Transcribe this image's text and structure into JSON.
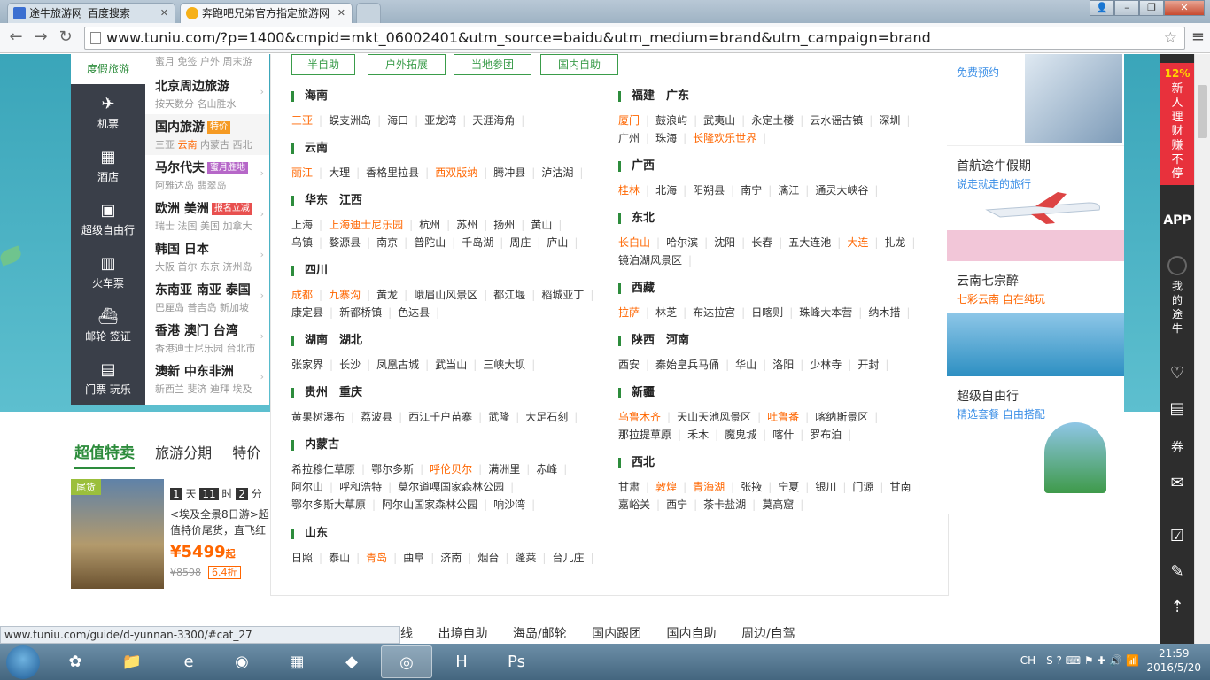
{
  "browser": {
    "tabs": [
      {
        "title": "途牛旅游网_百度搜索"
      },
      {
        "title": "奔跑吧兄弟官方指定旅游网"
      }
    ],
    "url": "www.tuniu.com/?p=1400&cmpid=mkt_06002401&utm_source=baidu&utm_medium=brand&utm_campaign=brand",
    "status_url": "www.tuniu.com/guide/d-yunnan-3300/#cat_27"
  },
  "nav": {
    "top_label": "度假旅游",
    "items": [
      {
        "icon": "airplane-icon",
        "label": "机票"
      },
      {
        "icon": "hotel-icon",
        "label": "酒店"
      },
      {
        "icon": "suitcase-icon",
        "label": "超级自由行"
      },
      {
        "icon": "train-icon",
        "label": "火车票"
      },
      {
        "icon": "cruise-ship-icon",
        "label": "邮轮 签证"
      },
      {
        "icon": "ticket-icon",
        "label": "门票 玩乐"
      }
    ]
  },
  "categories": [
    {
      "title": "",
      "sub": "蜜月 免签 户外 周末游",
      "badge": ""
    },
    {
      "title": "北京周边旅游",
      "sub": "按天数分 名山胜水",
      "badge": ""
    },
    {
      "title": "国内旅游",
      "sub_a": "三亚 ",
      "sub_hl": "云南",
      "sub_b": " 内蒙古 西北",
      "badge": "特价",
      "badge_color": "#f59a23"
    },
    {
      "title": "马尔代夫",
      "sub": "阿雅达岛 翡翠岛",
      "badge": "蜜月胜地",
      "badge_color": "#b667c8"
    },
    {
      "title": "欧洲 美洲",
      "sub": "瑞士 法国 美国 加拿大",
      "badge": "报名立减",
      "badge_color": "#e8504f"
    },
    {
      "title": "韩国 日本",
      "sub": "大阪 首尔 东京 济州岛",
      "badge": ""
    },
    {
      "title": "东南亚 南亚 泰国",
      "sub": "巴厘岛 普吉岛 新加坡",
      "badge": ""
    },
    {
      "title": "香港 澳门 台湾",
      "sub": "香港迪士尼乐园 台北市",
      "badge": ""
    },
    {
      "title": "澳新 中东非洲",
      "sub": "新西兰 斐济 迪拜 埃及",
      "badge": ""
    }
  ],
  "tag_buttons": [
    "半自助",
    "户外拓展",
    "当地参团",
    "国内自助"
  ],
  "regions_left": [
    {
      "title": "海南",
      "places": [
        {
          "n": "三亚",
          "h": true
        },
        {
          "n": "蜈支洲岛"
        },
        {
          "n": "海口"
        },
        {
          "n": "亚龙湾"
        },
        {
          "n": "天涯海角"
        }
      ]
    },
    {
      "title": "云南",
      "places": [
        {
          "n": "丽江",
          "h": true
        },
        {
          "n": "大理"
        },
        {
          "n": "香格里拉县"
        },
        {
          "n": "西双版纳",
          "h": true
        },
        {
          "n": "腾冲县"
        },
        {
          "n": "泸沽湖"
        }
      ]
    },
    {
      "title": "华东　江西",
      "places": [
        {
          "n": "上海"
        },
        {
          "n": "上海迪士尼乐园",
          "h": true
        },
        {
          "n": "杭州"
        },
        {
          "n": "苏州"
        },
        {
          "n": "扬州"
        },
        {
          "n": "黄山"
        },
        {
          "n": "乌镇"
        },
        {
          "n": "婺源县"
        },
        {
          "n": "南京"
        },
        {
          "n": "普陀山"
        },
        {
          "n": "千岛湖"
        },
        {
          "n": "周庄"
        },
        {
          "n": "庐山"
        }
      ]
    },
    {
      "title": "四川",
      "places": [
        {
          "n": "成都",
          "h": true
        },
        {
          "n": "九寨沟",
          "h": true
        },
        {
          "n": "黄龙"
        },
        {
          "n": "峨眉山风景区"
        },
        {
          "n": "都江堰"
        },
        {
          "n": "稻城亚丁"
        },
        {
          "n": "康定县"
        },
        {
          "n": "新都桥镇"
        },
        {
          "n": "色达县"
        }
      ]
    },
    {
      "title": "湖南　湖北",
      "places": [
        {
          "n": "张家界"
        },
        {
          "n": "长沙"
        },
        {
          "n": "凤凰古城"
        },
        {
          "n": "武当山"
        },
        {
          "n": "三峡大坝"
        }
      ]
    },
    {
      "title": "贵州　重庆",
      "places": [
        {
          "n": "黄果树瀑布"
        },
        {
          "n": "荔波县"
        },
        {
          "n": "西江千户苗寨"
        },
        {
          "n": "武隆"
        },
        {
          "n": "大足石刻"
        }
      ]
    },
    {
      "title": "内蒙古",
      "places": [
        {
          "n": "希拉穆仁草原"
        },
        {
          "n": "鄂尔多斯"
        },
        {
          "n": "呼伦贝尔",
          "h": true
        },
        {
          "n": "满洲里"
        },
        {
          "n": "赤峰"
        },
        {
          "n": "阿尔山"
        },
        {
          "n": "呼和浩特"
        },
        {
          "n": "莫尔道嘎国家森林公园"
        },
        {
          "n": "鄂尔多斯大草原"
        },
        {
          "n": "阿尔山国家森林公园"
        },
        {
          "n": "响沙湾"
        }
      ]
    },
    {
      "title": "山东",
      "places": [
        {
          "n": "日照"
        },
        {
          "n": "泰山"
        },
        {
          "n": "青岛",
          "h": true
        },
        {
          "n": "曲阜"
        },
        {
          "n": "济南"
        },
        {
          "n": "烟台"
        },
        {
          "n": "蓬莱"
        },
        {
          "n": "台儿庄"
        }
      ]
    }
  ],
  "regions_right": [
    {
      "title": "福建　广东",
      "places": [
        {
          "n": "厦门",
          "h": true
        },
        {
          "n": "鼓浪屿"
        },
        {
          "n": "武夷山"
        },
        {
          "n": "永定土楼"
        },
        {
          "n": "云水谣古镇"
        },
        {
          "n": "深圳"
        },
        {
          "n": "广州"
        },
        {
          "n": "珠海"
        },
        {
          "n": "长隆欢乐世界",
          "h": true
        }
      ]
    },
    {
      "title": "广西",
      "places": [
        {
          "n": "桂林",
          "h": true
        },
        {
          "n": "北海"
        },
        {
          "n": "阳朔县"
        },
        {
          "n": "南宁"
        },
        {
          "n": "漓江"
        },
        {
          "n": "通灵大峡谷"
        }
      ]
    },
    {
      "title": "东北",
      "places": [
        {
          "n": "长白山",
          "h": true
        },
        {
          "n": "哈尔滨"
        },
        {
          "n": "沈阳"
        },
        {
          "n": "长春"
        },
        {
          "n": "五大连池"
        },
        {
          "n": "大连",
          "h": true
        },
        {
          "n": "扎龙"
        },
        {
          "n": "镜泊湖风景区"
        }
      ]
    },
    {
      "title": "西藏",
      "places": [
        {
          "n": "拉萨",
          "h": true
        },
        {
          "n": "林芝"
        },
        {
          "n": "布达拉宫"
        },
        {
          "n": "日喀则"
        },
        {
          "n": "珠峰大本营"
        },
        {
          "n": "纳木措"
        }
      ]
    },
    {
      "title": "陕西　河南",
      "places": [
        {
          "n": "西安"
        },
        {
          "n": "秦始皇兵马俑"
        },
        {
          "n": "华山"
        },
        {
          "n": "洛阳"
        },
        {
          "n": "少林寺"
        },
        {
          "n": "开封"
        }
      ]
    },
    {
      "title": "新疆",
      "places": [
        {
          "n": "乌鲁木齐",
          "h": true
        },
        {
          "n": "天山天池风景区"
        },
        {
          "n": "吐鲁番",
          "h": true
        },
        {
          "n": "喀纳斯景区"
        },
        {
          "n": "那拉提草原"
        },
        {
          "n": "禾木"
        },
        {
          "n": "魔鬼城"
        },
        {
          "n": "喀什"
        },
        {
          "n": "罗布泊"
        }
      ]
    },
    {
      "title": "西北",
      "places": [
        {
          "n": "甘肃"
        },
        {
          "n": "敦煌",
          "h": true
        },
        {
          "n": "青海湖",
          "h": true
        },
        {
          "n": "张掖"
        },
        {
          "n": "宁夏"
        },
        {
          "n": "银川"
        },
        {
          "n": "门源"
        },
        {
          "n": "甘南"
        },
        {
          "n": "嘉峪关"
        },
        {
          "n": "西宁"
        },
        {
          "n": "茶卡盐湖"
        },
        {
          "n": "莫高窟"
        }
      ]
    }
  ],
  "promos": [
    {
      "title": "",
      "sub": "免费预约",
      "sub_color": "#3a8ee6"
    },
    {
      "title": "首航途牛假期",
      "sub": "说走就走的旅行",
      "sub_color": "#3a8ee6"
    },
    {
      "title": "云南七宗醉",
      "sub": "七彩云南 自在纯玩",
      "sub_color": "#f60"
    },
    {
      "title": "超级自由行",
      "sub": "精选套餐 自由搭配",
      "sub_color": "#3a8ee6"
    }
  ],
  "right_sidebar": {
    "ad_pct": "12%",
    "ad_text": "新人理财赚不停",
    "app_label": "APP",
    "my_label": "我的途牛",
    "coupon_label": "券"
  },
  "lower": {
    "tabs": [
      "超值特卖",
      "旅游分期",
      "特价"
    ],
    "deal": {
      "tag": "尾货",
      "countdown": [
        {
          "v": "1",
          "u": "天"
        },
        {
          "v": "11",
          "u": "时"
        },
        {
          "v": "2",
          "u": "分"
        }
      ],
      "title": "<埃及全景8日游>超值特价尾货，直飞红",
      "price": "¥5499",
      "price_suffix": "起",
      "old_price": "¥8598",
      "discount": "6.4折"
    },
    "subnav": [
      "线",
      "出境自助",
      "海岛/邮轮",
      "国内跟团",
      "国内自助",
      "周边/自驾"
    ]
  },
  "taskbar": {
    "time": "21:59",
    "date": "2016/5/20",
    "ime": "CH"
  }
}
